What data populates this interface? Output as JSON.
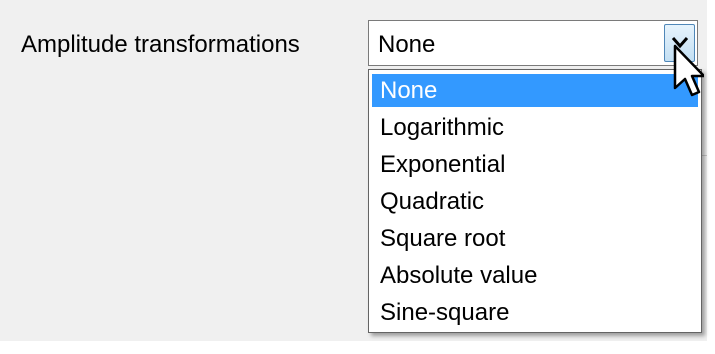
{
  "field": {
    "label": "Amplitude transformations",
    "selected_value": "None"
  },
  "dropdown": {
    "options": [
      "None",
      "Logarithmic",
      "Exponential",
      "Quadratic",
      "Square root",
      "Absolute value",
      "Sine-square"
    ],
    "highlighted_option": "None"
  },
  "icons": {
    "dropdown_arrow": "chevron-down-icon",
    "cursor": "mouse-pointer-icon"
  },
  "colors": {
    "selection": "#3399ff",
    "panel_background": "#f0f0f0"
  }
}
